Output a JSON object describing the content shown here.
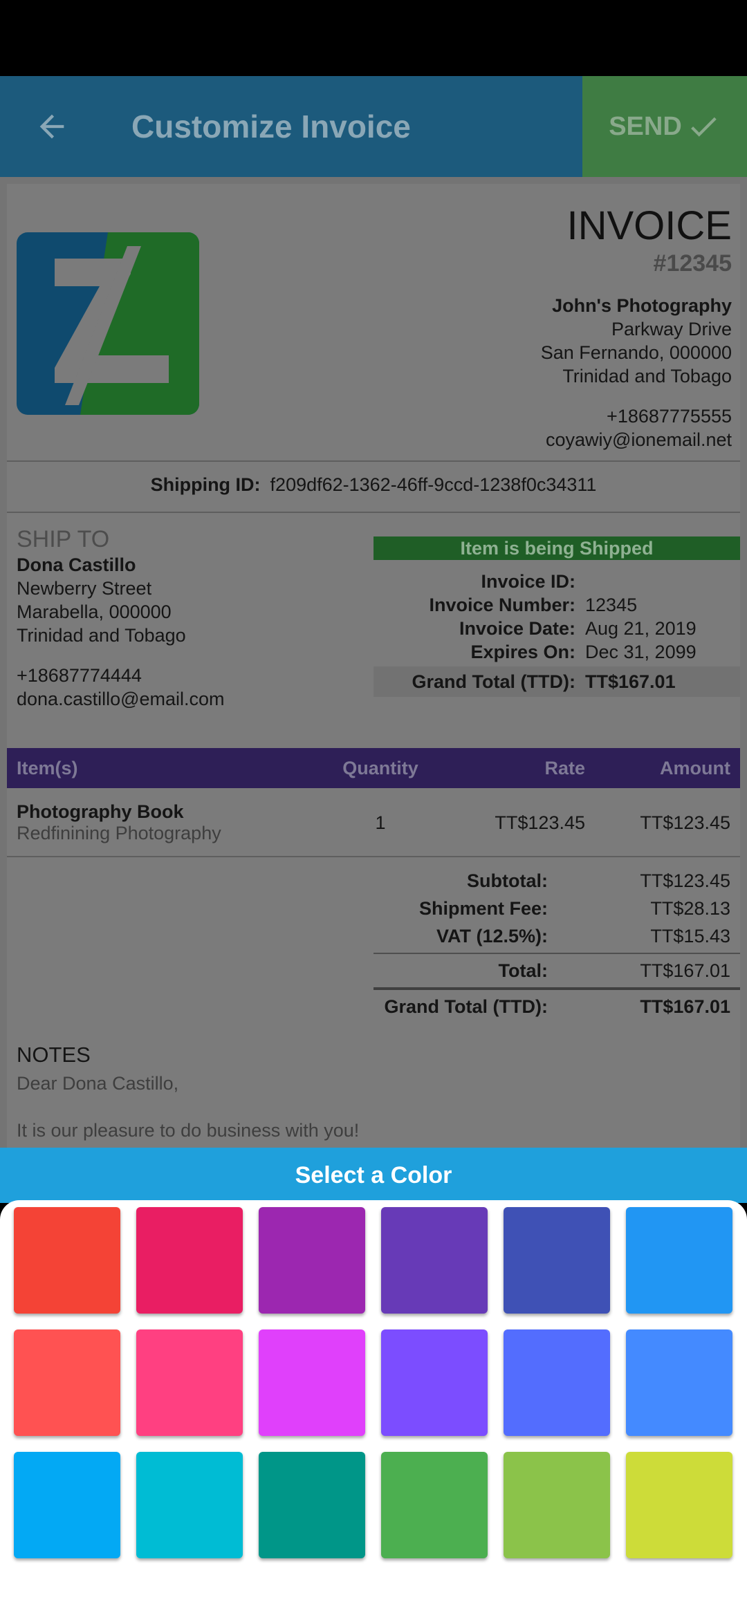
{
  "appbar": {
    "title": "Customize Invoice",
    "send_label": "SEND"
  },
  "invoice": {
    "heading": "INVOICE",
    "number_display": "#12345",
    "business": {
      "name": "John's Photography",
      "street": "Parkway Drive",
      "city": "San Fernando, 000000",
      "country": "Trinidad and Tobago",
      "phone": "+18687775555",
      "email": "coyawiy@ionemail.net"
    },
    "shipping_id_label": "Shipping ID:",
    "shipping_id": "f209df62-1362-46ff-9ccd-1238f0c34311",
    "ship_to": {
      "heading": "SHIP TO",
      "name": "Dona Castillo",
      "street": "Newberry Street",
      "city": "Marabella, 000000",
      "country": "Trinidad and Tobago",
      "phone": "+18687774444",
      "email": "dona.castillo@email.com"
    },
    "status": "Item is being Shipped",
    "meta": [
      {
        "label": "Invoice ID:",
        "value": ""
      },
      {
        "label": "Invoice Number:",
        "value": "12345"
      },
      {
        "label": "Invoice Date:",
        "value": "Aug 21, 2019"
      },
      {
        "label": "Expires On:",
        "value": "Dec 31, 2099"
      }
    ],
    "meta_total": {
      "label": "Grand Total (TTD):",
      "value": "TT$167.01"
    },
    "table_headers": {
      "item": "Item(s)",
      "quantity": "Quantity",
      "rate": "Rate",
      "amount": "Amount"
    },
    "items": [
      {
        "name": "Photography Book",
        "description": "Redfinining Photography",
        "quantity": "1",
        "rate": "TT$123.45",
        "amount": "TT$123.45"
      }
    ],
    "totals": {
      "subtotal_label": "Subtotal:",
      "subtotal": "TT$123.45",
      "shipment_label": "Shipment Fee:",
      "shipment": "TT$28.13",
      "vat_label": "VAT (12.5%):",
      "vat": "TT$15.43",
      "total_label": "Total:",
      "total": "TT$167.01",
      "grand_label": "Grand Total (TTD):",
      "grand": "TT$167.01"
    },
    "notes": {
      "heading": "NOTES",
      "line1": "Dear Dona Castillo,",
      "line2": "It is our pleasure to do business with you!"
    }
  },
  "color_picker": {
    "title": "Select a Color",
    "colors": [
      "#f44336",
      "#e91e63",
      "#9c27b0",
      "#673ab7",
      "#3f51b5",
      "#2196f3",
      "#ff5252",
      "#ff4081",
      "#e040fb",
      "#7c4dff",
      "#536dfe",
      "#448aff",
      "#03a9f4",
      "#00bcd4",
      "#009688",
      "#4caf50",
      "#8bc34a",
      "#cddc39"
    ]
  },
  "theme": {
    "logo_blue": "#0f4a6e",
    "logo_green": "#1f6b27"
  }
}
